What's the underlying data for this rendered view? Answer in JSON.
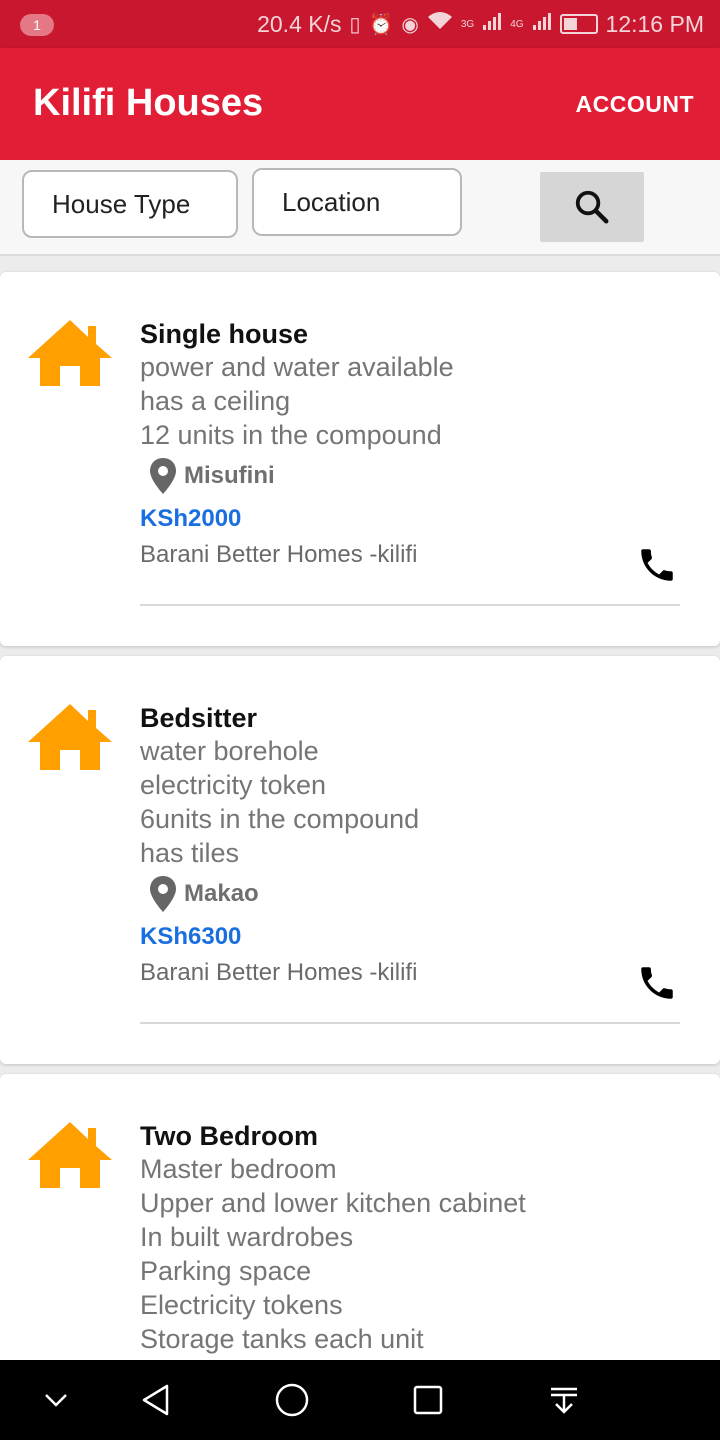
{
  "status_bar": {
    "notification_count": "1",
    "speed": "20.4 K/s",
    "net_3g": "3G",
    "net_4g": "4G",
    "time": "12:16 PM",
    "battery_level": 0.45
  },
  "app_bar": {
    "title": "Kilifi Houses",
    "account_label": "ACCOUNT",
    "color": "#e21e36"
  },
  "filters": {
    "house_type_label": "House Type",
    "location_label": "Location",
    "search_icon": "search-icon"
  },
  "listings": [
    {
      "title": "Single house",
      "description": [
        "power and water available",
        "has a ceiling",
        "12 units in the compound"
      ],
      "location": "Misufini",
      "price": "KSh2000",
      "agent": "Barani Better Homes -kilifi"
    },
    {
      "title": "Bedsitter",
      "description": [
        "water borehole",
        "electricity token",
        "6units in the compound",
        "has tiles"
      ],
      "location": "Makao",
      "price": "KSh6300",
      "agent": "Barani Better Homes -kilifi"
    },
    {
      "title": "Two Bedroom",
      "description": [
        "Master bedroom",
        "Upper and lower kitchen cabinet",
        "In built wardrobes",
        "Parking space",
        "Electricity tokens",
        "Storage tanks each unit"
      ]
    }
  ],
  "colors": {
    "house_icon": "#ffa000",
    "price": "#1a6fe0"
  }
}
